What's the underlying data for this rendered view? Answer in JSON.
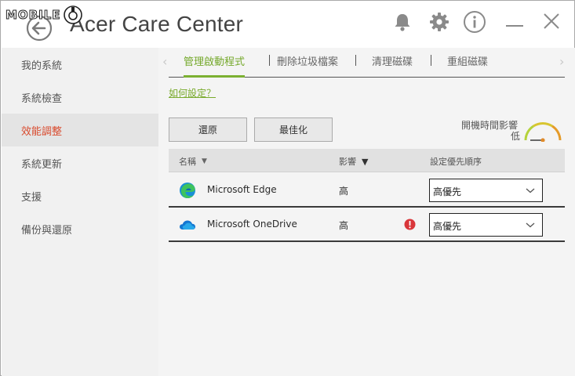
{
  "watermark": {
    "text": "MOBILE"
  },
  "window": {
    "title": "Acer Care Center"
  },
  "sidebar": {
    "items": [
      {
        "label": "我的系統"
      },
      {
        "label": "系統檢查"
      },
      {
        "label": "效能調整",
        "active": true
      },
      {
        "label": "系統更新"
      },
      {
        "label": "支援"
      },
      {
        "label": "備份與還原"
      }
    ]
  },
  "tabs": [
    {
      "label": "管理啟動程式",
      "active": true
    },
    {
      "label": "刪除垃圾檔案"
    },
    {
      "label": "清理磁碟"
    },
    {
      "label": "重組磁碟"
    }
  ],
  "help_link": "如何設定？",
  "buttons": {
    "restore": "還原",
    "optimize": "最佳化"
  },
  "boot_impact": {
    "label": "開機時間影響",
    "value": "低"
  },
  "table": {
    "columns": {
      "name": "名稱",
      "impact": "影響",
      "priority": "設定優先順序"
    },
    "rows": [
      {
        "name": "Microsoft Edge",
        "impact": "高",
        "priority": "高優先",
        "icon": "edge-icon",
        "warning": false
      },
      {
        "name": "Microsoft OneDrive",
        "impact": "高",
        "priority": "高優先",
        "icon": "onedrive-icon",
        "warning": true
      }
    ]
  },
  "colors": {
    "accent_green": "#7cb032",
    "active_sidebar_text": "#d9492c",
    "warning_red": "#d9363a"
  }
}
